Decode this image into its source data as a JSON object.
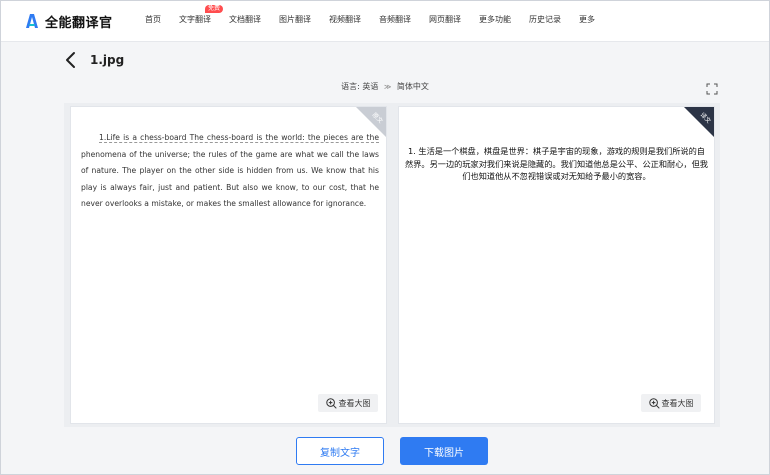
{
  "header": {
    "app_name": "全能翻译官",
    "nav": [
      {
        "label": "首页"
      },
      {
        "label": "文字翻译",
        "badge": "免费"
      },
      {
        "label": "文档翻译"
      },
      {
        "label": "图片翻译"
      },
      {
        "label": "视频翻译"
      },
      {
        "label": "音频翻译"
      },
      {
        "label": "网页翻译"
      },
      {
        "label": "更多功能"
      },
      {
        "label": "历史记录"
      },
      {
        "label": "更多"
      }
    ]
  },
  "file": {
    "title": "1.jpg"
  },
  "language": {
    "prefix": "语言:",
    "source": "英语",
    "separator": "≫",
    "target": "简体中文"
  },
  "source_panel": {
    "corner_label": "原文",
    "text_first": "1.Life is a chess-board The chess-board is the world: the pieces are the",
    "text_rest": "phenomena of the universe; the rules of the game are what we call the laws of nature. The player on the other side is hidden from us. We know that his play is always fair, just and patient. But also we know, to our cost, that he never overlooks a mistake, or makes the smallest allowance for ignorance.",
    "view_label": "查看大图"
  },
  "translation_panel": {
    "corner_label": "译文",
    "text": "1. 生活是一个棋盘，棋盘是世界：棋子是宇宙的现象，游戏的规则是我们所说的自然界。另一边的玩家对我们来说是隐藏的。我们知道他总是公平、公正和耐心，但我们也知道他从不忽视错误或对无知给予最小的宽容。",
    "view_label": "查看大图"
  },
  "actions": {
    "copy_label": "复制文字",
    "download_label": "下载图片"
  },
  "colors": {
    "accent": "#2f7bf2",
    "badge": "#ff4d4f",
    "corner_dark": "#2c3446"
  },
  "icons": [
    "logo-icon",
    "back-arrow-icon",
    "fullscreen-icon",
    "zoom-in-icon"
  ]
}
